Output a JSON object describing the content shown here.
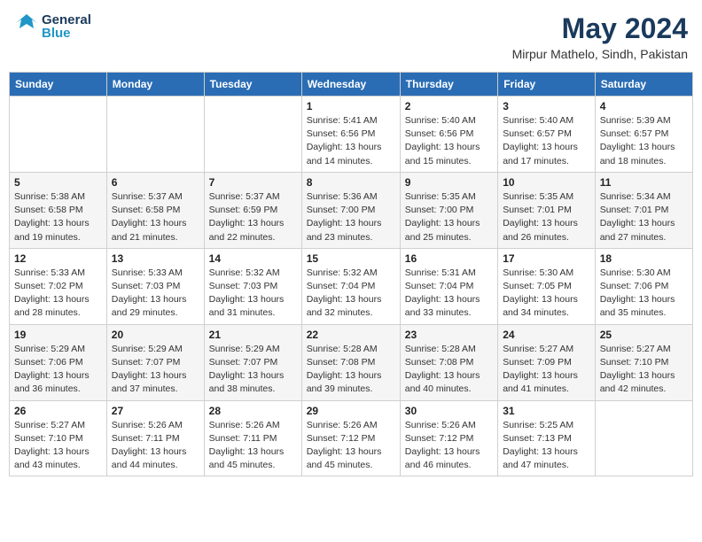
{
  "header": {
    "logo_general": "General",
    "logo_blue": "Blue",
    "month": "May 2024",
    "location": "Mirpur Mathelo, Sindh, Pakistan"
  },
  "days_of_week": [
    "Sunday",
    "Monday",
    "Tuesday",
    "Wednesday",
    "Thursday",
    "Friday",
    "Saturday"
  ],
  "weeks": [
    [
      {
        "day": "",
        "info": ""
      },
      {
        "day": "",
        "info": ""
      },
      {
        "day": "",
        "info": ""
      },
      {
        "day": "1",
        "info": "Sunrise: 5:41 AM\nSunset: 6:56 PM\nDaylight: 13 hours\nand 14 minutes."
      },
      {
        "day": "2",
        "info": "Sunrise: 5:40 AM\nSunset: 6:56 PM\nDaylight: 13 hours\nand 15 minutes."
      },
      {
        "day": "3",
        "info": "Sunrise: 5:40 AM\nSunset: 6:57 PM\nDaylight: 13 hours\nand 17 minutes."
      },
      {
        "day": "4",
        "info": "Sunrise: 5:39 AM\nSunset: 6:57 PM\nDaylight: 13 hours\nand 18 minutes."
      }
    ],
    [
      {
        "day": "5",
        "info": "Sunrise: 5:38 AM\nSunset: 6:58 PM\nDaylight: 13 hours\nand 19 minutes."
      },
      {
        "day": "6",
        "info": "Sunrise: 5:37 AM\nSunset: 6:58 PM\nDaylight: 13 hours\nand 21 minutes."
      },
      {
        "day": "7",
        "info": "Sunrise: 5:37 AM\nSunset: 6:59 PM\nDaylight: 13 hours\nand 22 minutes."
      },
      {
        "day": "8",
        "info": "Sunrise: 5:36 AM\nSunset: 7:00 PM\nDaylight: 13 hours\nand 23 minutes."
      },
      {
        "day": "9",
        "info": "Sunrise: 5:35 AM\nSunset: 7:00 PM\nDaylight: 13 hours\nand 25 minutes."
      },
      {
        "day": "10",
        "info": "Sunrise: 5:35 AM\nSunset: 7:01 PM\nDaylight: 13 hours\nand 26 minutes."
      },
      {
        "day": "11",
        "info": "Sunrise: 5:34 AM\nSunset: 7:01 PM\nDaylight: 13 hours\nand 27 minutes."
      }
    ],
    [
      {
        "day": "12",
        "info": "Sunrise: 5:33 AM\nSunset: 7:02 PM\nDaylight: 13 hours\nand 28 minutes."
      },
      {
        "day": "13",
        "info": "Sunrise: 5:33 AM\nSunset: 7:03 PM\nDaylight: 13 hours\nand 29 minutes."
      },
      {
        "day": "14",
        "info": "Sunrise: 5:32 AM\nSunset: 7:03 PM\nDaylight: 13 hours\nand 31 minutes."
      },
      {
        "day": "15",
        "info": "Sunrise: 5:32 AM\nSunset: 7:04 PM\nDaylight: 13 hours\nand 32 minutes."
      },
      {
        "day": "16",
        "info": "Sunrise: 5:31 AM\nSunset: 7:04 PM\nDaylight: 13 hours\nand 33 minutes."
      },
      {
        "day": "17",
        "info": "Sunrise: 5:30 AM\nSunset: 7:05 PM\nDaylight: 13 hours\nand 34 minutes."
      },
      {
        "day": "18",
        "info": "Sunrise: 5:30 AM\nSunset: 7:06 PM\nDaylight: 13 hours\nand 35 minutes."
      }
    ],
    [
      {
        "day": "19",
        "info": "Sunrise: 5:29 AM\nSunset: 7:06 PM\nDaylight: 13 hours\nand 36 minutes."
      },
      {
        "day": "20",
        "info": "Sunrise: 5:29 AM\nSunset: 7:07 PM\nDaylight: 13 hours\nand 37 minutes."
      },
      {
        "day": "21",
        "info": "Sunrise: 5:29 AM\nSunset: 7:07 PM\nDaylight: 13 hours\nand 38 minutes."
      },
      {
        "day": "22",
        "info": "Sunrise: 5:28 AM\nSunset: 7:08 PM\nDaylight: 13 hours\nand 39 minutes."
      },
      {
        "day": "23",
        "info": "Sunrise: 5:28 AM\nSunset: 7:08 PM\nDaylight: 13 hours\nand 40 minutes."
      },
      {
        "day": "24",
        "info": "Sunrise: 5:27 AM\nSunset: 7:09 PM\nDaylight: 13 hours\nand 41 minutes."
      },
      {
        "day": "25",
        "info": "Sunrise: 5:27 AM\nSunset: 7:10 PM\nDaylight: 13 hours\nand 42 minutes."
      }
    ],
    [
      {
        "day": "26",
        "info": "Sunrise: 5:27 AM\nSunset: 7:10 PM\nDaylight: 13 hours\nand 43 minutes."
      },
      {
        "day": "27",
        "info": "Sunrise: 5:26 AM\nSunset: 7:11 PM\nDaylight: 13 hours\nand 44 minutes."
      },
      {
        "day": "28",
        "info": "Sunrise: 5:26 AM\nSunset: 7:11 PM\nDaylight: 13 hours\nand 45 minutes."
      },
      {
        "day": "29",
        "info": "Sunrise: 5:26 AM\nSunset: 7:12 PM\nDaylight: 13 hours\nand 45 minutes."
      },
      {
        "day": "30",
        "info": "Sunrise: 5:26 AM\nSunset: 7:12 PM\nDaylight: 13 hours\nand 46 minutes."
      },
      {
        "day": "31",
        "info": "Sunrise: 5:25 AM\nSunset: 7:13 PM\nDaylight: 13 hours\nand 47 minutes."
      },
      {
        "day": "",
        "info": ""
      }
    ]
  ]
}
